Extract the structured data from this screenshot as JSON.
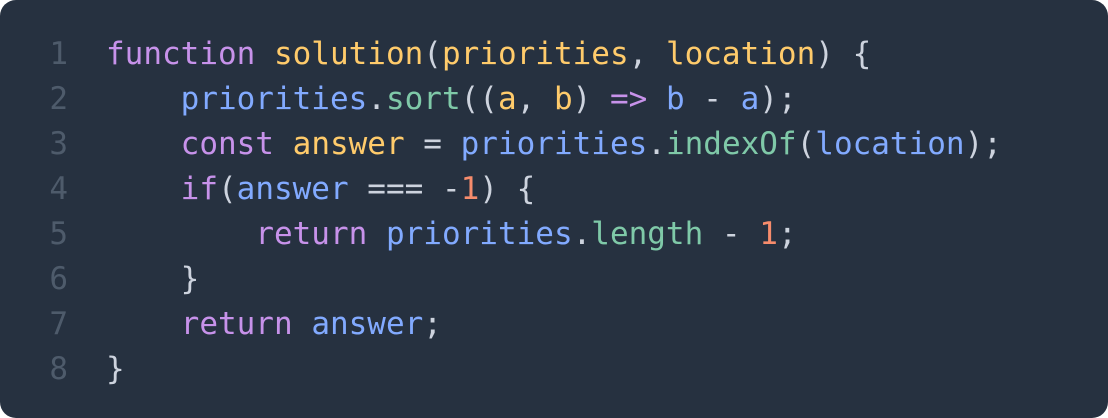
{
  "theme": {
    "background": "#263140",
    "line_number": "#4e5b6b",
    "colors": {
      "keyword": "#c792ea",
      "function": "#ffcb6b",
      "param": "#ffcb6b",
      "variable": "#82aaff",
      "method": "#7fc9a8",
      "number": "#f78c6c",
      "operator": "#89ddff",
      "punct": "#cdd3de",
      "plain": "#cdd3de"
    }
  },
  "lines": [
    {
      "number": "1",
      "tokens": [
        {
          "text": "function",
          "type": "keyword"
        },
        {
          "text": " ",
          "type": "plain"
        },
        {
          "text": "solution",
          "type": "function"
        },
        {
          "text": "(",
          "type": "punct"
        },
        {
          "text": "priorities",
          "type": "param"
        },
        {
          "text": ", ",
          "type": "punct"
        },
        {
          "text": "location",
          "type": "param"
        },
        {
          "text": ") {",
          "type": "punct"
        }
      ]
    },
    {
      "number": "2",
      "tokens": [
        {
          "text": "    ",
          "type": "plain"
        },
        {
          "text": "priorities",
          "type": "variable"
        },
        {
          "text": ".",
          "type": "punct"
        },
        {
          "text": "sort",
          "type": "method"
        },
        {
          "text": "((",
          "type": "punct"
        },
        {
          "text": "a",
          "type": "param"
        },
        {
          "text": ", ",
          "type": "punct"
        },
        {
          "text": "b",
          "type": "param"
        },
        {
          "text": ") ",
          "type": "punct"
        },
        {
          "text": "=>",
          "type": "keyword"
        },
        {
          "text": " ",
          "type": "plain"
        },
        {
          "text": "b",
          "type": "variable"
        },
        {
          "text": " - ",
          "type": "punct"
        },
        {
          "text": "a",
          "type": "variable"
        },
        {
          "text": ");",
          "type": "punct"
        }
      ]
    },
    {
      "number": "3",
      "tokens": [
        {
          "text": "    ",
          "type": "plain"
        },
        {
          "text": "const",
          "type": "keyword"
        },
        {
          "text": " ",
          "type": "plain"
        },
        {
          "text": "answer",
          "type": "function"
        },
        {
          "text": " = ",
          "type": "punct"
        },
        {
          "text": "priorities",
          "type": "variable"
        },
        {
          "text": ".",
          "type": "punct"
        },
        {
          "text": "indexOf",
          "type": "method"
        },
        {
          "text": "(",
          "type": "punct"
        },
        {
          "text": "location",
          "type": "variable"
        },
        {
          "text": ");",
          "type": "punct"
        }
      ]
    },
    {
      "number": "4",
      "tokens": [
        {
          "text": "    ",
          "type": "plain"
        },
        {
          "text": "if",
          "type": "keyword"
        },
        {
          "text": "(",
          "type": "punct"
        },
        {
          "text": "answer",
          "type": "variable"
        },
        {
          "text": " === -",
          "type": "punct"
        },
        {
          "text": "1",
          "type": "number"
        },
        {
          "text": ") {",
          "type": "punct"
        }
      ]
    },
    {
      "number": "5",
      "tokens": [
        {
          "text": "        ",
          "type": "plain"
        },
        {
          "text": "return",
          "type": "keyword"
        },
        {
          "text": " ",
          "type": "plain"
        },
        {
          "text": "priorities",
          "type": "variable"
        },
        {
          "text": ".",
          "type": "punct"
        },
        {
          "text": "length",
          "type": "method"
        },
        {
          "text": " - ",
          "type": "punct"
        },
        {
          "text": "1",
          "type": "number"
        },
        {
          "text": ";",
          "type": "punct"
        }
      ]
    },
    {
      "number": "6",
      "tokens": [
        {
          "text": "    ",
          "type": "plain"
        },
        {
          "text": "}",
          "type": "punct"
        }
      ]
    },
    {
      "number": "7",
      "tokens": [
        {
          "text": "    ",
          "type": "plain"
        },
        {
          "text": "return",
          "type": "keyword"
        },
        {
          "text": " ",
          "type": "plain"
        },
        {
          "text": "answer",
          "type": "variable"
        },
        {
          "text": ";",
          "type": "punct"
        }
      ]
    },
    {
      "number": "8",
      "tokens": [
        {
          "text": "}",
          "type": "punct"
        }
      ]
    }
  ]
}
